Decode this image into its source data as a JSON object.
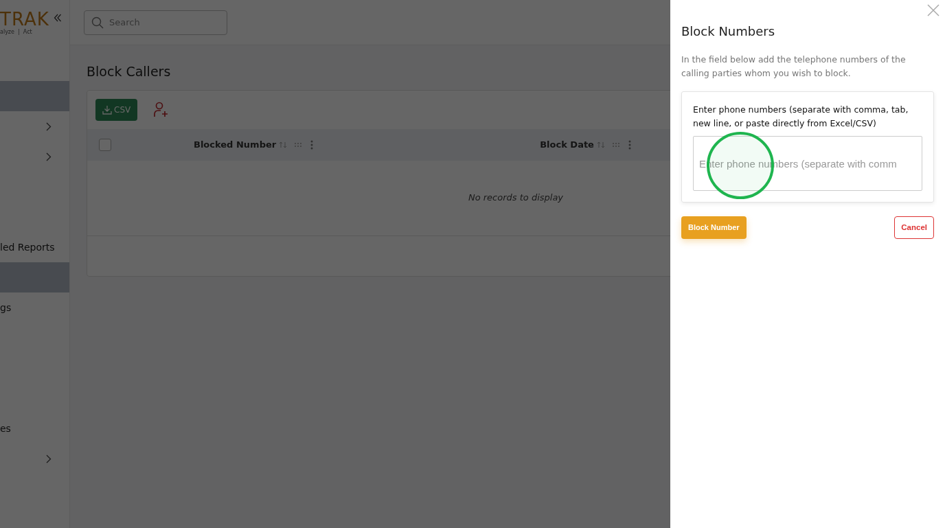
{
  "sidebar": {
    "logo": "TRAK",
    "tagline": "alyze  |  Act",
    "items": [
      {
        "selected": true
      },
      {
        "chevron": true,
        "selected": false
      },
      {
        "chevron": true,
        "selected": false
      },
      {
        "label": "led Reports",
        "selected": false
      },
      {
        "selected": true
      },
      {
        "label": "gs",
        "selected": false
      },
      {
        "label": "es",
        "selected": false
      },
      {
        "chevron": true,
        "selected": false
      }
    ]
  },
  "search": {
    "placeholder": "Search"
  },
  "page_title": "Block Callers",
  "toolbar": {
    "csv_button": "CSV"
  },
  "table": {
    "select_all_checked": false,
    "columns": [
      {
        "label": "Blocked Number"
      },
      {
        "label": "Block Date"
      }
    ],
    "empty_message": "No records to display"
  },
  "drawer": {
    "title": "Block Numbers",
    "description": "In the field below add the telephone numbers of the calling parties whom you wish to block.",
    "field_label": "Enter phone numbers (separate with comma, tab, new line, or paste directly from Excel/CSV)",
    "placeholder": "Enter phone numbers (separate with comm",
    "primary_button": "Block Number",
    "cancel_button": "Cancel"
  }
}
